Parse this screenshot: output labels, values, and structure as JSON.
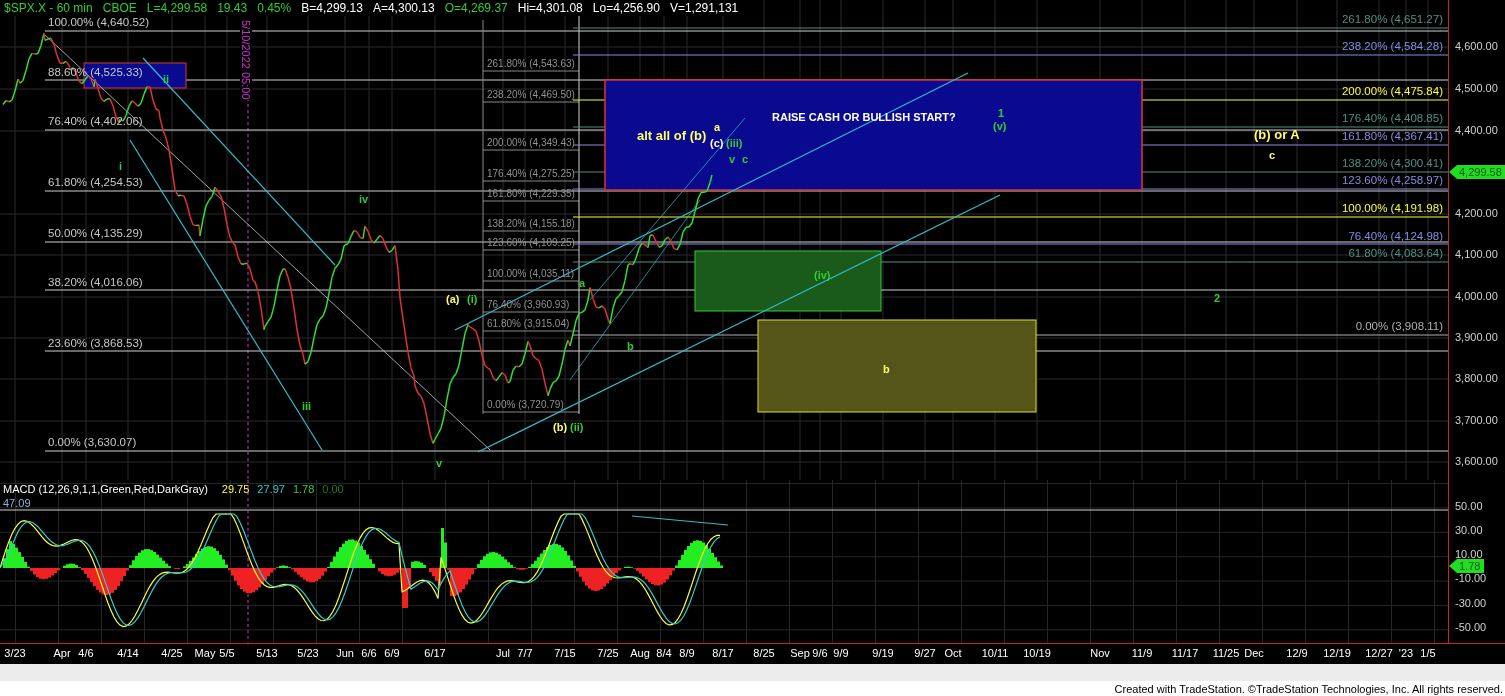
{
  "quote_bar": [
    {
      "text": "$SPX.X - 60 min",
      "color": "#33cc33"
    },
    {
      "text": "CBOE",
      "color": "#33cc33"
    },
    {
      "text": "L=4,299.58",
      "color": "#33cc33"
    },
    {
      "text": "19.43",
      "color": "#33cc33"
    },
    {
      "text": "0.45%",
      "color": "#33cc33"
    },
    {
      "text": "B=4,299.13",
      "color": "#ffffff"
    },
    {
      "text": "A=4,300.13",
      "color": "#ffffff"
    },
    {
      "text": "O=4,269.37",
      "color": "#33cc33"
    },
    {
      "text": "Hi=4,301.08",
      "color": "#ffffff"
    },
    {
      "text": "Lo=4,256.90",
      "color": "#ffffff"
    },
    {
      "text": "V=1,291,131",
      "color": "#ffffff"
    }
  ],
  "price_chart": {
    "date_marker": "5/10/2022 05:00",
    "fib_levels_left": [
      "100.00% (4,640.52)",
      "88.60% (4,525.33)",
      "76.40% (4,402.06)",
      "61.80% (4,254.53)",
      "50.00% (4,135.29)",
      "38.20% (4,016.06)",
      "23.60% (3,868.53)",
      "0.00% (3,630.07)"
    ],
    "fib_levels_middle": [
      "261.80% (4,543.63)",
      "238.20% (4,469.50)",
      "200.00% (4,349.43)",
      "176.40% (4,275.25)",
      "161.80% (4,229.35)",
      "138.20% (4,155.18)",
      "123.60% (4,109.25)",
      "100.00% (4,035.11)",
      "76.40% (3,960.93)",
      "61.80% (3,915.04)",
      "0.00% (3,720.79)"
    ],
    "fib_levels_right": [
      {
        "label": "261.80% (4,651.27)",
        "color": "#4f8f86"
      },
      {
        "label": "238.20% (4,584.28)",
        "color": "#8a8ae0"
      },
      {
        "label": "200.00% (4,475.84)",
        "color": "#ffff33"
      },
      {
        "label": "176.40% (4,408.85)",
        "color": "#4f8f86"
      },
      {
        "label": "161.80% (4,367.41)",
        "color": "#8a8ae0"
      },
      {
        "label": "138.20% (4,300.41)",
        "color": "#4f8f86"
      },
      {
        "label": "123.60% (4,258.97)",
        "color": "#8a8ae0"
      },
      {
        "label": "100.00% (4,191.98)",
        "color": "#ffff33"
      },
      {
        "label": "76.40% (4,124.98)",
        "color": "#8a8ae0"
      },
      {
        "label": "61.80% (4,083.64)",
        "color": "#4f8f86"
      },
      {
        "label": "0.00% (3,908.11)",
        "color": "#b0b0b0"
      }
    ],
    "annotations": [
      {
        "text": "ii",
        "color": "#33cc33"
      },
      {
        "text": "i",
        "color": "#33cc33"
      },
      {
        "text": "iv",
        "color": "#33cc33"
      },
      {
        "text": "iii",
        "color": "#33cc33"
      },
      {
        "text": "v",
        "color": "#33cc33"
      },
      {
        "text": "(a)",
        "color": "#ffff66"
      },
      {
        "text": "(i)",
        "color": "#33cc33"
      },
      {
        "text": "(b)",
        "color": "#ffff66"
      },
      {
        "text": "(ii)",
        "color": "#33cc33"
      },
      {
        "text": "a",
        "color": "#33cc33"
      },
      {
        "text": "b",
        "color": "#33cc33"
      },
      {
        "text": "alt all of (b)",
        "color": "#ffff66"
      },
      {
        "text": "a",
        "color": "#ffff66"
      },
      {
        "text": "(c)",
        "color": "#ffffff"
      },
      {
        "text": "(iii)",
        "color": "#33cc33"
      },
      {
        "text": "v",
        "color": "#33cc33"
      },
      {
        "text": "c",
        "color": "#33cc33"
      },
      {
        "text": "RAISE CASH OR BULLISH START?",
        "color": "#ffffff"
      },
      {
        "text": "1",
        "color": "#33cc33"
      },
      {
        "text": "(v)",
        "color": "#33cc33"
      },
      {
        "text": "(iv)",
        "color": "#33cc33"
      },
      {
        "text": "b",
        "color": "#ffff66"
      },
      {
        "text": "(b) or A",
        "color": "#ffff66"
      },
      {
        "text": "c",
        "color": "#ffff66"
      },
      {
        "text": "2",
        "color": "#33cc33"
      }
    ],
    "y_axis": [
      "4,600.00",
      "4,500.00",
      "4,400.00",
      "4,200.00",
      "4,100.00",
      "4,000.00",
      "3,900.00",
      "3,800.00",
      "3,700.00",
      "3,600.00"
    ],
    "last_price": "4,299.58"
  },
  "macd": {
    "title": "MACD (12,26,9,1,1,Green,Red,DarkGray)",
    "values": [
      {
        "text": "29.75",
        "color": "#ffff33"
      },
      {
        "text": "27.97",
        "color": "#33cccc"
      },
      {
        "text": "1.78",
        "color": "#33cc33"
      },
      {
        "text": "0.00",
        "color": "#1f7a1f"
      }
    ],
    "top_reading": "47.09",
    "y_axis": [
      "50.00",
      "30.00",
      "10.00",
      "-10.00",
      "-30.00",
      "-50.00"
    ],
    "last_value": "1.78"
  },
  "time_axis": [
    "3/23",
    "Apr",
    "4/6",
    "4/14",
    "4/25",
    "May",
    "5/5",
    "5/13",
    "5/23",
    "Jun",
    "6/6",
    "6/9",
    "6/17",
    "Jul",
    "7/7",
    "7/15",
    "7/25",
    "Aug",
    "8/4",
    "8/9",
    "8/17",
    "8/25",
    "Sep",
    "9/6",
    "9/9",
    "9/19",
    "9/27",
    "Oct",
    "10/11",
    "10/19",
    "Nov",
    "11/9",
    "11/17",
    "11/25",
    "Dec",
    "12/9",
    "12/19",
    "12/27",
    "'23",
    "1/5"
  ],
  "footer": "Created with TradeStation. ©TradeStation Technologies, Inc. All rights reserved."
}
